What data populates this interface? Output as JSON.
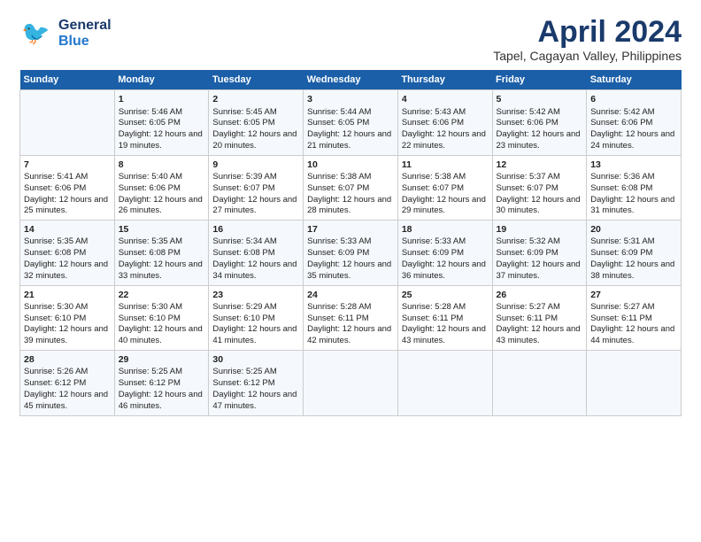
{
  "header": {
    "logo_general": "General",
    "logo_blue": "Blue",
    "title": "April 2024",
    "subtitle": "Tapel, Cagayan Valley, Philippines"
  },
  "columns": [
    "Sunday",
    "Monday",
    "Tuesday",
    "Wednesday",
    "Thursday",
    "Friday",
    "Saturday"
  ],
  "weeks": [
    [
      {
        "day": "",
        "sunrise": "",
        "sunset": "",
        "daylight": ""
      },
      {
        "day": "1",
        "sunrise": "Sunrise: 5:46 AM",
        "sunset": "Sunset: 6:05 PM",
        "daylight": "Daylight: 12 hours and 19 minutes."
      },
      {
        "day": "2",
        "sunrise": "Sunrise: 5:45 AM",
        "sunset": "Sunset: 6:05 PM",
        "daylight": "Daylight: 12 hours and 20 minutes."
      },
      {
        "day": "3",
        "sunrise": "Sunrise: 5:44 AM",
        "sunset": "Sunset: 6:05 PM",
        "daylight": "Daylight: 12 hours and 21 minutes."
      },
      {
        "day": "4",
        "sunrise": "Sunrise: 5:43 AM",
        "sunset": "Sunset: 6:06 PM",
        "daylight": "Daylight: 12 hours and 22 minutes."
      },
      {
        "day": "5",
        "sunrise": "Sunrise: 5:42 AM",
        "sunset": "Sunset: 6:06 PM",
        "daylight": "Daylight: 12 hours and 23 minutes."
      },
      {
        "day": "6",
        "sunrise": "Sunrise: 5:42 AM",
        "sunset": "Sunset: 6:06 PM",
        "daylight": "Daylight: 12 hours and 24 minutes."
      }
    ],
    [
      {
        "day": "7",
        "sunrise": "Sunrise: 5:41 AM",
        "sunset": "Sunset: 6:06 PM",
        "daylight": "Daylight: 12 hours and 25 minutes."
      },
      {
        "day": "8",
        "sunrise": "Sunrise: 5:40 AM",
        "sunset": "Sunset: 6:06 PM",
        "daylight": "Daylight: 12 hours and 26 minutes."
      },
      {
        "day": "9",
        "sunrise": "Sunrise: 5:39 AM",
        "sunset": "Sunset: 6:07 PM",
        "daylight": "Daylight: 12 hours and 27 minutes."
      },
      {
        "day": "10",
        "sunrise": "Sunrise: 5:38 AM",
        "sunset": "Sunset: 6:07 PM",
        "daylight": "Daylight: 12 hours and 28 minutes."
      },
      {
        "day": "11",
        "sunrise": "Sunrise: 5:38 AM",
        "sunset": "Sunset: 6:07 PM",
        "daylight": "Daylight: 12 hours and 29 minutes."
      },
      {
        "day": "12",
        "sunrise": "Sunrise: 5:37 AM",
        "sunset": "Sunset: 6:07 PM",
        "daylight": "Daylight: 12 hours and 30 minutes."
      },
      {
        "day": "13",
        "sunrise": "Sunrise: 5:36 AM",
        "sunset": "Sunset: 6:08 PM",
        "daylight": "Daylight: 12 hours and 31 minutes."
      }
    ],
    [
      {
        "day": "14",
        "sunrise": "Sunrise: 5:35 AM",
        "sunset": "Sunset: 6:08 PM",
        "daylight": "Daylight: 12 hours and 32 minutes."
      },
      {
        "day": "15",
        "sunrise": "Sunrise: 5:35 AM",
        "sunset": "Sunset: 6:08 PM",
        "daylight": "Daylight: 12 hours and 33 minutes."
      },
      {
        "day": "16",
        "sunrise": "Sunrise: 5:34 AM",
        "sunset": "Sunset: 6:08 PM",
        "daylight": "Daylight: 12 hours and 34 minutes."
      },
      {
        "day": "17",
        "sunrise": "Sunrise: 5:33 AM",
        "sunset": "Sunset: 6:09 PM",
        "daylight": "Daylight: 12 hours and 35 minutes."
      },
      {
        "day": "18",
        "sunrise": "Sunrise: 5:33 AM",
        "sunset": "Sunset: 6:09 PM",
        "daylight": "Daylight: 12 hours and 36 minutes."
      },
      {
        "day": "19",
        "sunrise": "Sunrise: 5:32 AM",
        "sunset": "Sunset: 6:09 PM",
        "daylight": "Daylight: 12 hours and 37 minutes."
      },
      {
        "day": "20",
        "sunrise": "Sunrise: 5:31 AM",
        "sunset": "Sunset: 6:09 PM",
        "daylight": "Daylight: 12 hours and 38 minutes."
      }
    ],
    [
      {
        "day": "21",
        "sunrise": "Sunrise: 5:30 AM",
        "sunset": "Sunset: 6:10 PM",
        "daylight": "Daylight: 12 hours and 39 minutes."
      },
      {
        "day": "22",
        "sunrise": "Sunrise: 5:30 AM",
        "sunset": "Sunset: 6:10 PM",
        "daylight": "Daylight: 12 hours and 40 minutes."
      },
      {
        "day": "23",
        "sunrise": "Sunrise: 5:29 AM",
        "sunset": "Sunset: 6:10 PM",
        "daylight": "Daylight: 12 hours and 41 minutes."
      },
      {
        "day": "24",
        "sunrise": "Sunrise: 5:28 AM",
        "sunset": "Sunset: 6:11 PM",
        "daylight": "Daylight: 12 hours and 42 minutes."
      },
      {
        "day": "25",
        "sunrise": "Sunrise: 5:28 AM",
        "sunset": "Sunset: 6:11 PM",
        "daylight": "Daylight: 12 hours and 43 minutes."
      },
      {
        "day": "26",
        "sunrise": "Sunrise: 5:27 AM",
        "sunset": "Sunset: 6:11 PM",
        "daylight": "Daylight: 12 hours and 43 minutes."
      },
      {
        "day": "27",
        "sunrise": "Sunrise: 5:27 AM",
        "sunset": "Sunset: 6:11 PM",
        "daylight": "Daylight: 12 hours and 44 minutes."
      }
    ],
    [
      {
        "day": "28",
        "sunrise": "Sunrise: 5:26 AM",
        "sunset": "Sunset: 6:12 PM",
        "daylight": "Daylight: 12 hours and 45 minutes."
      },
      {
        "day": "29",
        "sunrise": "Sunrise: 5:25 AM",
        "sunset": "Sunset: 6:12 PM",
        "daylight": "Daylight: 12 hours and 46 minutes."
      },
      {
        "day": "30",
        "sunrise": "Sunrise: 5:25 AM",
        "sunset": "Sunset: 6:12 PM",
        "daylight": "Daylight: 12 hours and 47 minutes."
      },
      {
        "day": "",
        "sunrise": "",
        "sunset": "",
        "daylight": ""
      },
      {
        "day": "",
        "sunrise": "",
        "sunset": "",
        "daylight": ""
      },
      {
        "day": "",
        "sunrise": "",
        "sunset": "",
        "daylight": ""
      },
      {
        "day": "",
        "sunrise": "",
        "sunset": "",
        "daylight": ""
      }
    ]
  ]
}
